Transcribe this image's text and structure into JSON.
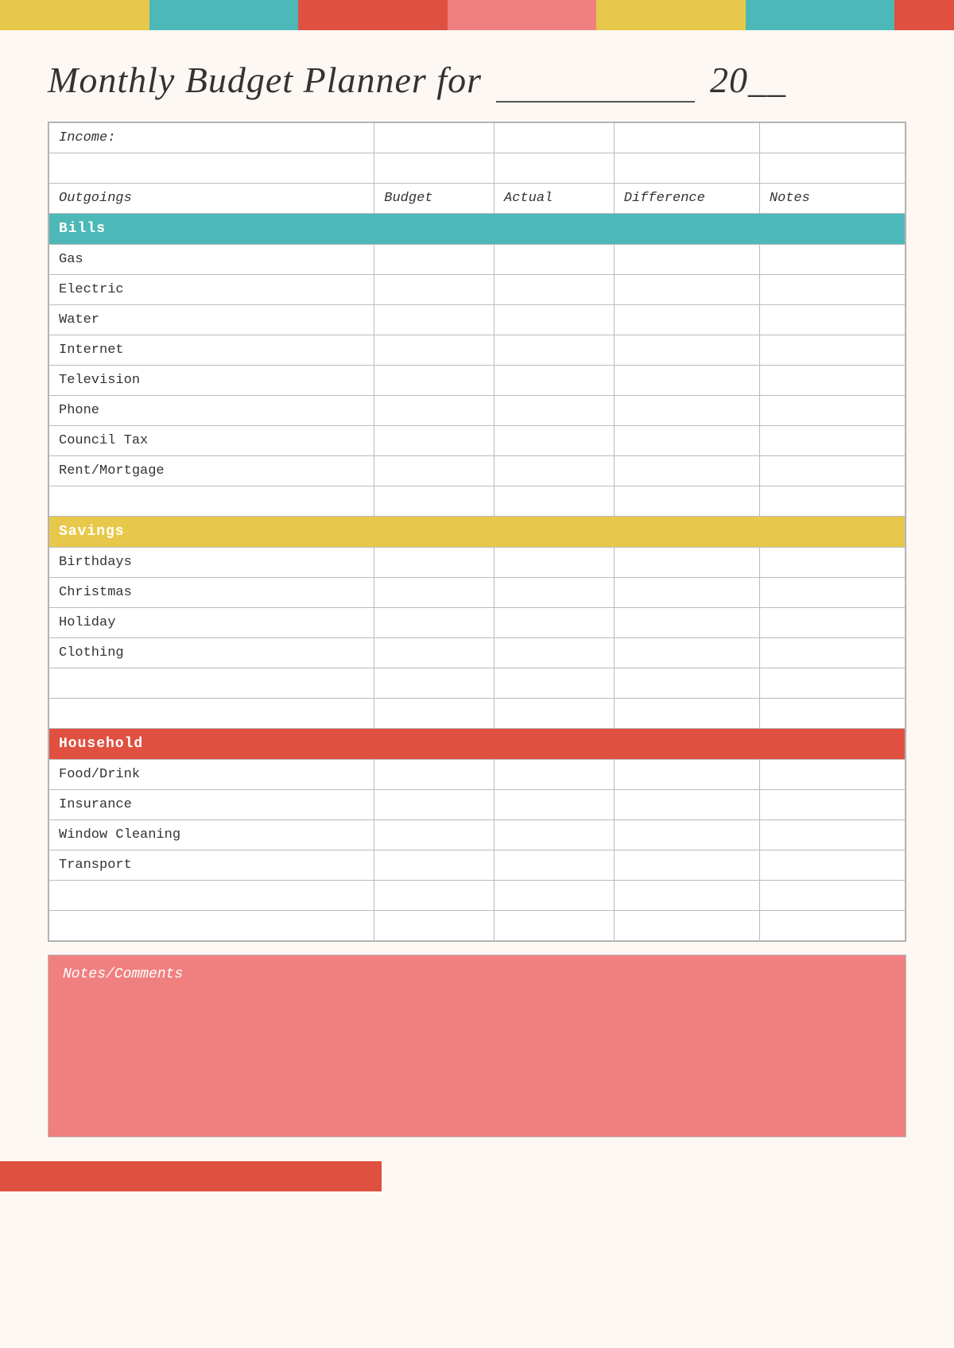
{
  "page": {
    "title": "Monthly Budget Planner for",
    "title_line": "_________",
    "title_year": "20__",
    "color_bars": [
      {
        "color": "yellow",
        "label": "yellow-seg-1"
      },
      {
        "color": "teal",
        "label": "teal-seg-1"
      },
      {
        "color": "red",
        "label": "red-seg-1"
      },
      {
        "color": "pink",
        "label": "pink-seg-1"
      },
      {
        "color": "yellow",
        "label": "yellow-seg-2"
      },
      {
        "color": "teal",
        "label": "teal-seg-2"
      },
      {
        "color": "small-red",
        "label": "small-red-seg"
      }
    ]
  },
  "table": {
    "income_label": "Income:",
    "outgoings": {
      "col0": "Outgoings",
      "col1": "Budget",
      "col2": "Actual",
      "col3": "Difference",
      "col4": "Notes"
    },
    "sections": {
      "bills": {
        "header": "Bills",
        "rows": [
          "Gas",
          "Electric",
          "Water",
          "Internet",
          "Television",
          "Phone",
          "Council Tax",
          "Rent/Mortgage"
        ]
      },
      "savings": {
        "header": "Savings",
        "rows": [
          "Birthdays",
          "Christmas",
          "Holiday",
          "Clothing"
        ]
      },
      "household": {
        "header": "Household",
        "rows": [
          "Food/Drink",
          "Insurance",
          "Window Cleaning",
          "Transport"
        ]
      }
    }
  },
  "notes": {
    "label": "Notes/Comments"
  }
}
